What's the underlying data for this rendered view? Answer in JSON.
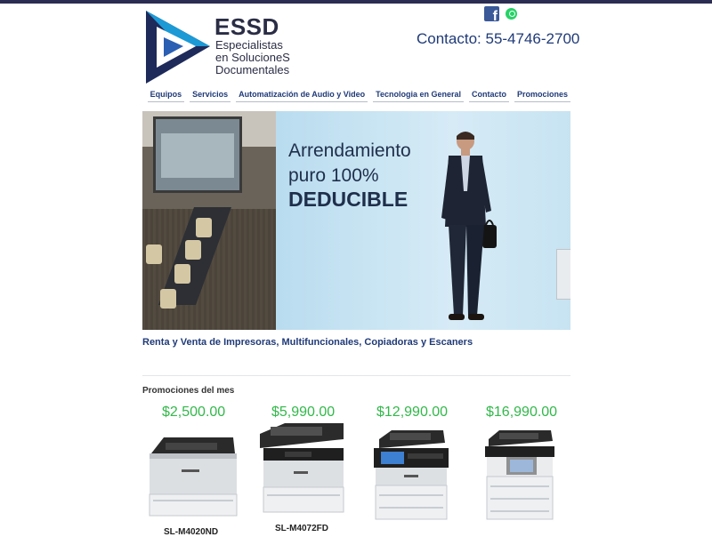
{
  "brand": {
    "name": "ESSD",
    "tagline_lines": [
      "Especialistas",
      "en SolucioneS",
      "Documentales"
    ]
  },
  "social": {
    "facebook_icon": "facebook-icon",
    "whatsapp_icon": "whatsapp-icon",
    "facebook_letter": "f"
  },
  "contact": "Contacto: 55-4746-2700",
  "nav": {
    "items": [
      {
        "label": "Equipos"
      },
      {
        "label": "Servicios"
      },
      {
        "label": "Automatización de Audio y Video"
      },
      {
        "label": "Tecnologia en General"
      },
      {
        "label": "Contacto"
      },
      {
        "label": "Promociones"
      }
    ]
  },
  "banner": {
    "line1": "Arrendamiento",
    "line2": "puro 100%",
    "line3": "DEDUCIBLE"
  },
  "tagline": "Renta y Venta de Impresoras, Multifuncionales, Copiadoras y Escaners",
  "promos": {
    "title": "Promociones del mes",
    "products": [
      {
        "price": "$2,500.00",
        "name": "SL-M4020ND"
      },
      {
        "price": "$5,990.00",
        "name": "SL-M4072FD"
      },
      {
        "price": "$12,990.00"
      },
      {
        "price": "$16,990.00"
      }
    ]
  },
  "colors": {
    "accent": "#1f3a78",
    "price_green": "#32b84a",
    "facebook": "#3b5998",
    "whatsapp": "#25d366"
  }
}
